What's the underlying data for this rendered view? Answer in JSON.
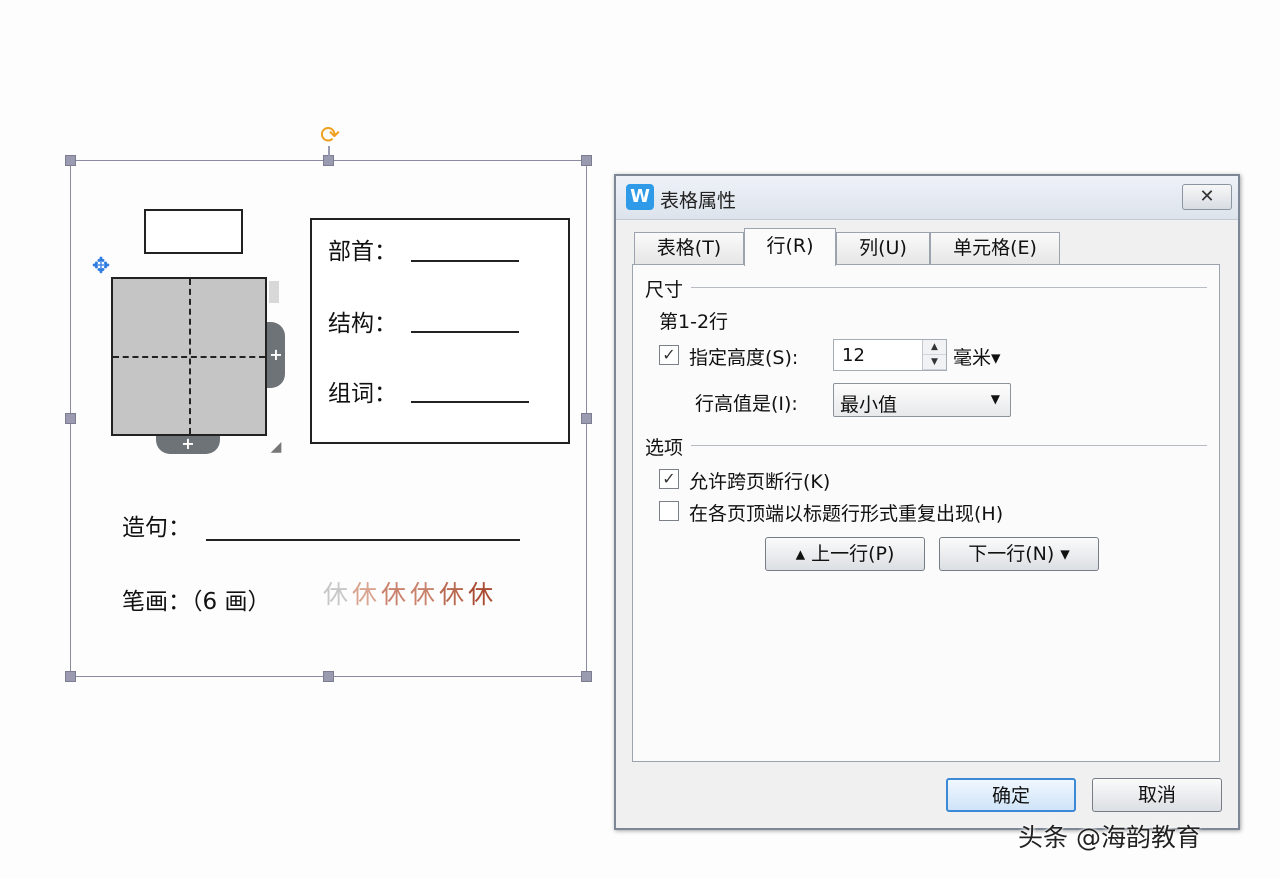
{
  "document": {
    "info_labels": [
      "部首：",
      "结构：",
      "组词："
    ],
    "sentence_label": "造句：",
    "stroke_label": "笔画：（6 画）",
    "stroke_chars": [
      {
        "char": "休",
        "color": "#c7c7c7"
      },
      {
        "char": "休",
        "color": "#d9a590"
      },
      {
        "char": "休",
        "color": "#c9826c"
      },
      {
        "char": "休",
        "color": "#c9826c"
      },
      {
        "char": "休",
        "color": "#b8694f"
      },
      {
        "char": "休",
        "color": "#a94a32"
      }
    ]
  },
  "dialog": {
    "app_icon": "W",
    "title": "表格属性",
    "close_symbol": "✕",
    "tabs": [
      "表格(T)",
      "行(R)",
      "列(U)",
      "单元格(E)"
    ],
    "active_tab": "行(R)",
    "size_group": "尺寸",
    "row_range": "第1-2行",
    "specify_height": {
      "label": "指定高度(S):",
      "checked": true
    },
    "height_value": "12",
    "height_unit": "毫米▾",
    "row_height_label": "行高值是(I):",
    "row_height_mode": "最小值",
    "options_group": "选项",
    "allow_break": {
      "label": "允许跨页断行(K)",
      "checked": true
    },
    "repeat_header": {
      "label": "在各页顶端以标题行形式重复出现(H)",
      "checked": false
    },
    "prev_row_btn": "▴ 上一行(P)",
    "next_row_btn": "下一行(N) ▾",
    "ok_btn": "确定",
    "cancel_btn": "取消"
  },
  "watermark": "头条 @海韵教育",
  "colors": {
    "accent": "#2f9be8",
    "handle": "#9a9ab0",
    "rotate": "#f0a020"
  }
}
